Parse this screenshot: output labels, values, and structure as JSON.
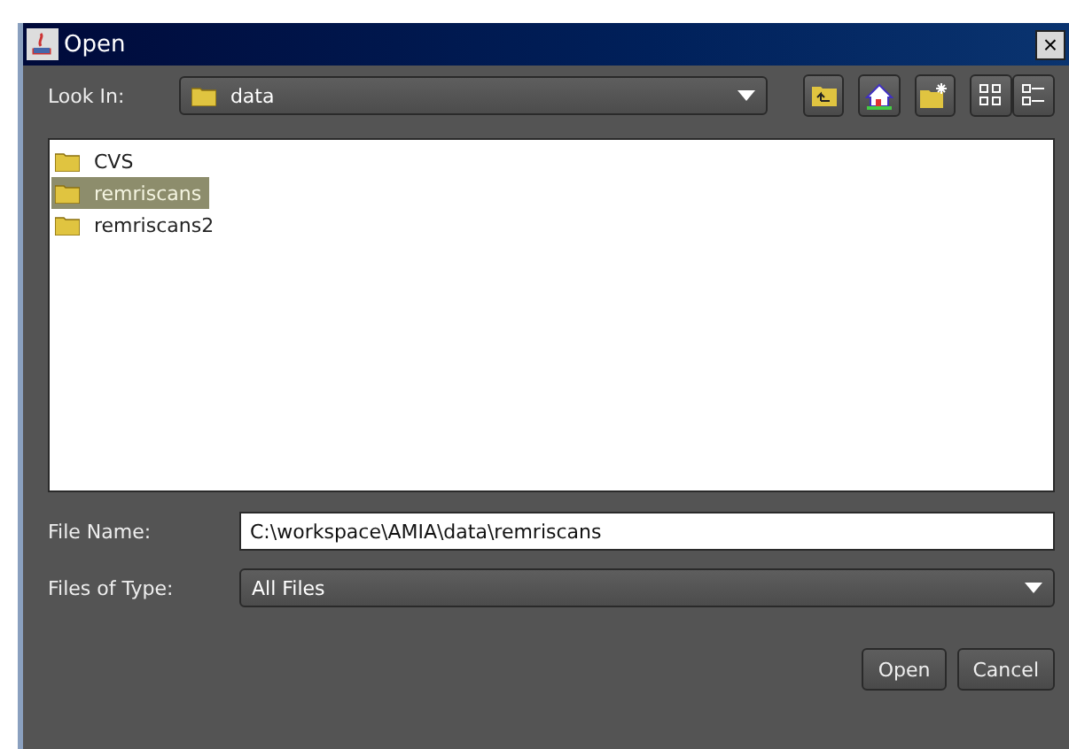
{
  "window": {
    "title": "Open",
    "close": "×"
  },
  "look_in": {
    "label": "Look In:",
    "value": "data"
  },
  "files": [
    {
      "name": "CVS",
      "selected": false
    },
    {
      "name": "remriscans",
      "selected": true
    },
    {
      "name": "remriscans2",
      "selected": false
    }
  ],
  "file_name": {
    "label": "File Name:",
    "value": "C:\\workspace\\AMIA\\data\\remriscans"
  },
  "files_of_type": {
    "label": "Files of Type:",
    "value": "All Files"
  },
  "buttons": [
    "Open",
    "Cancel"
  ]
}
